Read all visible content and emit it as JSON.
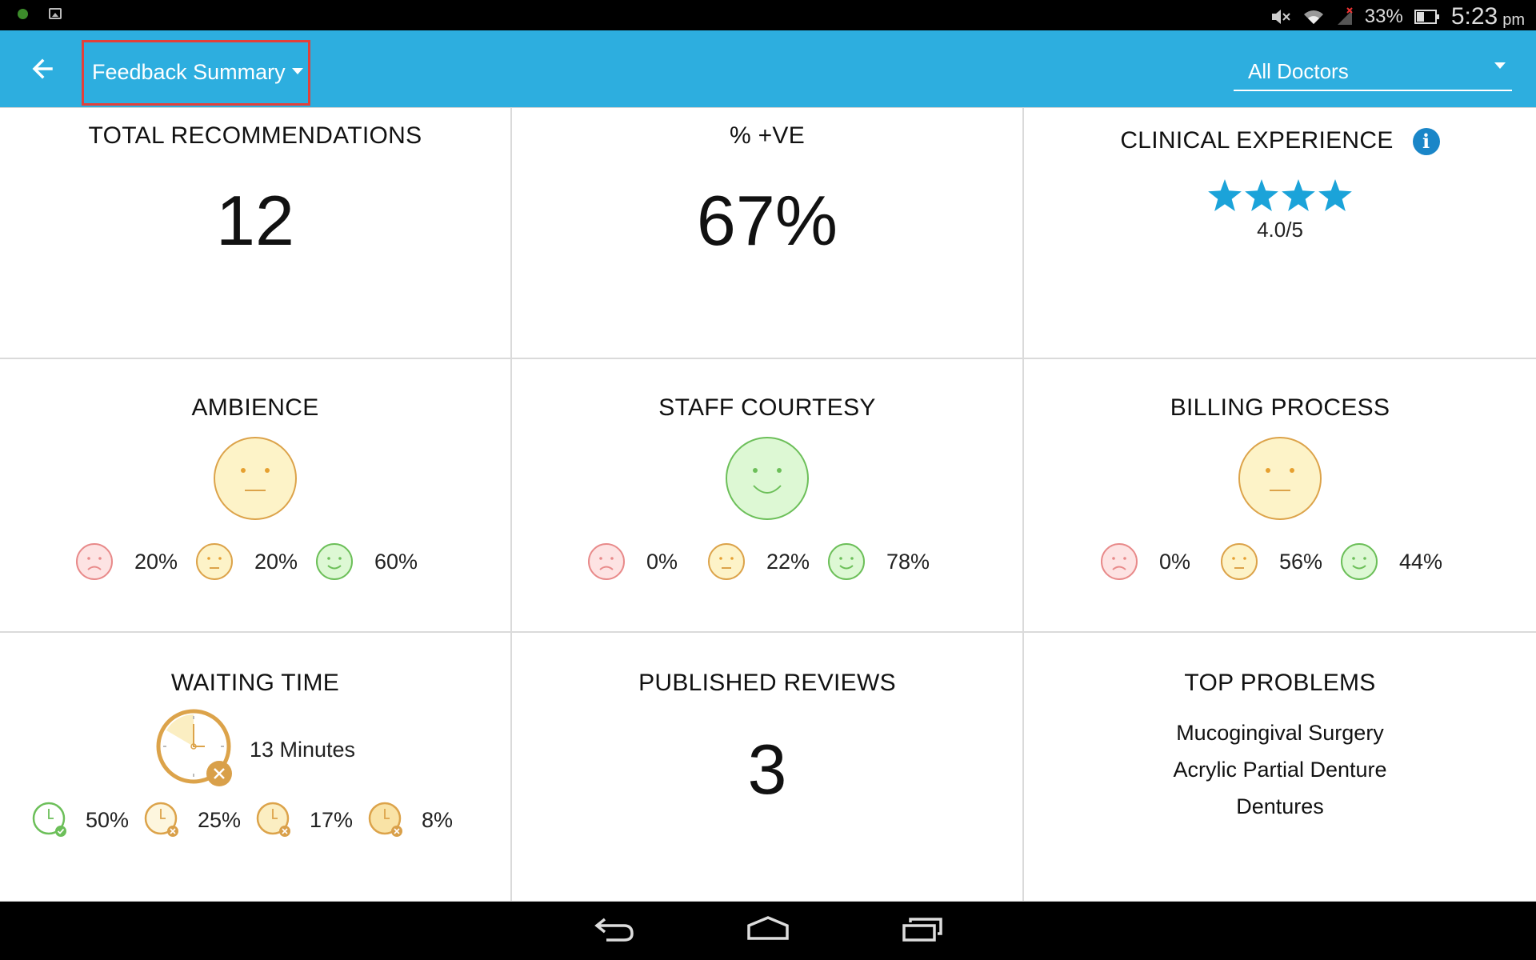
{
  "status_bar": {
    "battery": "33%",
    "time": "5:23",
    "ampm": "pm"
  },
  "app_bar": {
    "title": "Feedback Summary",
    "doctor_filter": "All Doctors"
  },
  "cards": {
    "total_recommendations": {
      "title": "TOTAL RECOMMENDATIONS",
      "value": "12"
    },
    "positive": {
      "title": "% +VE",
      "value": "67%"
    },
    "clinical_experience": {
      "title": "CLINICAL EXPERIENCE",
      "stars": 4,
      "rating": "4.0/5"
    },
    "ambience": {
      "title": "AMBIENCE",
      "overall": "neutral",
      "sad": "20%",
      "neutral": "20%",
      "happy": "60%"
    },
    "staff_courtesy": {
      "title": "STAFF COURTESY",
      "overall": "happy",
      "sad": "0%",
      "neutral": "22%",
      "happy": "78%"
    },
    "billing_process": {
      "title": "BILLING PROCESS",
      "overall": "neutral",
      "sad": "0%",
      "neutral": "56%",
      "happy": "44%"
    },
    "waiting_time": {
      "title": "WAITING TIME",
      "average": "13 Minutes",
      "buckets": [
        "50%",
        "25%",
        "17%",
        "8%"
      ]
    },
    "published_reviews": {
      "title": "PUBLISHED REVIEWS",
      "value": "3"
    },
    "top_problems": {
      "title": "TOP PROBLEMS",
      "items": [
        "Mucogingival Surgery",
        "Acrylic Partial Denture",
        "Dentures"
      ]
    }
  },
  "colors": {
    "app_bar": "#2daedf",
    "sad_stroke": "#e88a8a",
    "sad_fill": "#fde3e3",
    "neutral_stroke": "#dca34a",
    "neutral_fill": "#fdf3c8",
    "happy_stroke": "#6cbf59",
    "happy_fill": "#ddf8d4",
    "star": "#1ba3d9",
    "highlight_border": "#e2403a"
  }
}
